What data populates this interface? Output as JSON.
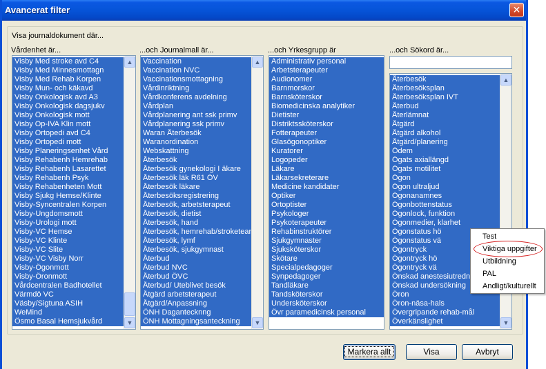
{
  "window": {
    "title": "Avancerat filter",
    "close_icon": "close-icon"
  },
  "group_caption": "Visa journaldokument där...",
  "columns": {
    "vardenhet": {
      "label": "Vårdenhet är...",
      "items": [
        "Visby Med stroke avd C4",
        "Visby Med Minnesmottagn",
        "Visby Med Rehab Korpen",
        "Visby Mun- och käkavd",
        "Visby Onkologisk avd A3",
        "Visby Onkologisk dagsjukv",
        "Visby Onkologisk mott",
        "Visby Op-IVA Klin mott",
        "Visby Ortopedi avd C4",
        "Visby Ortopedi mott",
        "Visby Planeringsenhet Vård",
        "Visby Rehabenh Hemrehab",
        "Visby Rehabenh Lasarettet",
        "Visby Rehabenh Psyk",
        "Visby Rehabenheten Mott",
        "Visby Sjukg Hemse/Klinte",
        "Visby-Syncentralen Korpen",
        "Visby-Ungdomsmott",
        "Visby-Urologi mott",
        "Visby-VC Hemse",
        "Visby-VC Klinte",
        "Visby-VC Slite",
        "Visby-VC Visby Norr",
        "Visby-Ögonmott",
        "Visby-Öronmott",
        "Vårdcentralen Badhotellet",
        "Värmdö VC",
        "Väsby/Sigtuna ASIH",
        "WeMind",
        "Ösmo Basal Hemsjukvård"
      ]
    },
    "journalmall": {
      "label": "...och Journalmall är...",
      "items": [
        "Vaccination",
        "Vaccination NVC",
        "Vaccinationsmottagning",
        "Vårdinriktning",
        "Vårdkonferens avdelning",
        "Vårdplan",
        "Vårdplanering ant ssk primv",
        "Vårdplanering ssk primv",
        "Waran Återbesök",
        "Waranordination",
        "Webskattning",
        "Återbesök",
        "Återbesök gynekologi I äkare",
        "Återbesök läk R61 ÖV",
        "Återbesök läkare",
        "Återbesöksregistrering",
        "Återbesök, arbetsterapeut",
        "Återbesök, dietist",
        "Återbesök, hand",
        "Återbesök, hemrehab/stroketean",
        "Återbesök, lymf",
        "Återbesök, sjukgymnast",
        "Återbud",
        "Återbud NVC",
        "Återbud ÖVC",
        "Återbud/ Uteblivet besök",
        "Åtgärd arbetsterapeut",
        "Åtgärd/Anpassning",
        "ÖNH Dagantecknng",
        "ÖNH Mottagningsanteckning"
      ]
    },
    "yrkesgrupp": {
      "label": "...och Yrkesgrupp är",
      "items": [
        "Administrativ personal",
        "Arbetsterapeuter",
        "Audionomer",
        "Barnmorskor",
        "Barnsköterskor",
        "Biomedicinska analytiker",
        "Dietister",
        "Distriktssköterskor",
        "Fotterapeuter",
        "Glasögonoptiker",
        "Kuratorer",
        "Logopeder",
        "Läkare",
        "Läkarsekreterare",
        "Medicine kandidater",
        "Optiker",
        "Ortoptister",
        "Psykologer",
        "Psykoterapeuter",
        "Rehabinstruktörer",
        "Sjukgymnaster",
        "Sjuksköterskor",
        "Skötare",
        "Specialpedagoger",
        "Synpedagoger",
        "Tandläkare",
        "Tandsköterskor",
        "Undersköterskor",
        "Övr paramedicinsk personal"
      ]
    },
    "sokord": {
      "label": "...och Sökord är...",
      "search_value": "",
      "items": [
        "Återbesök",
        "Återbesöksplan",
        "Återbesöksplan IVT",
        "Återbud",
        "Återlämnat",
        "Åtgärd",
        "Åtgärd alkohol",
        "Åtgärd/planering",
        "Ödem",
        "Ögats axiallängd",
        "Ögats motilitet",
        "Ögon",
        "Ögon ultraljud",
        "Ögonanamnes",
        "Ögonbottenstatus",
        "Ögonlock, funktion",
        "Ögonmedier, klarhet",
        "Ögonstatus hö",
        "Ögonstatus vä",
        "Ögontryck",
        "Ögontryck hö",
        "Ögontryck vä",
        "Önskad anestesiutredning",
        "Önskad undersökning",
        "Öron",
        "Öron-näsa-hals",
        "Övergripande rehab-mål",
        "Överkänslighet"
      ]
    }
  },
  "context_menu": {
    "items": [
      "Test",
      "Viktiga uppgifter",
      "Utbildning",
      "PAL",
      "Andligt/kulturellt"
    ]
  },
  "buttons": {
    "markera_alla": "Markera allt",
    "visa": "Visa",
    "avbryt": "Avbryt"
  }
}
